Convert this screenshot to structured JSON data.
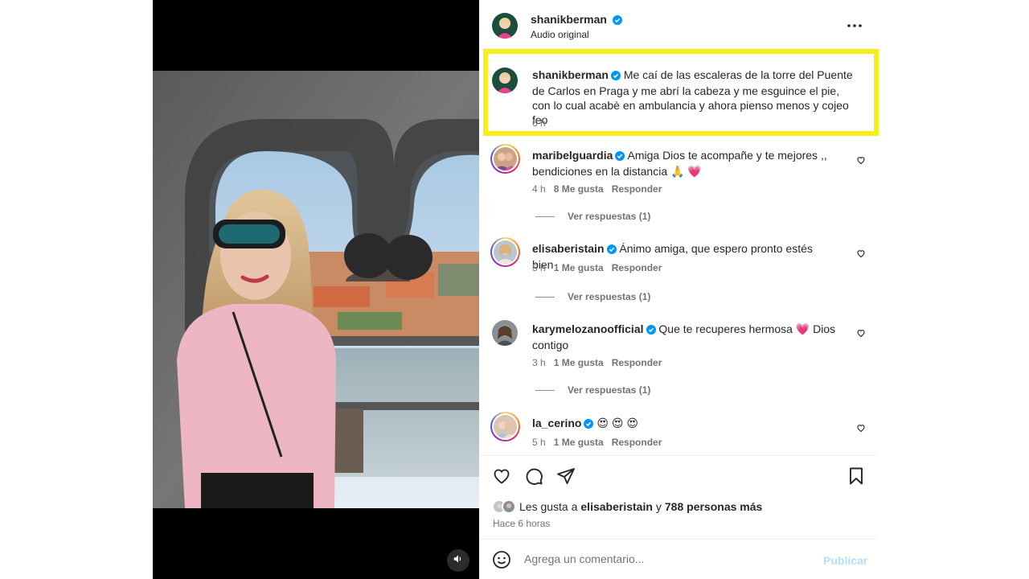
{
  "header": {
    "username": "shanikberman",
    "audio": "Audio original",
    "more_icon": "more-horizontal-icon"
  },
  "caption": {
    "username": "shanikberman",
    "text": "Me caí de las escaleras de la torre del Puente de Carlos en Praga y me abrí la cabeza y me esguince el pie, con lo cual acabè en ambulancia y ahora pienso menos y cojeo feo",
    "time": "6 h"
  },
  "comments": [
    {
      "username": "maribelguardia",
      "text": "Amiga Dios te acompañe y te mejores ,, bendiciones en la distancia 🙏 💗",
      "time": "4 h",
      "likes": "8 Me gusta",
      "reply": "Responder",
      "view_replies": "Ver respuestas (1)"
    },
    {
      "username": "elisaberistain",
      "text": "Ánimo amiga, que espero pronto estés bien",
      "time": "5 h",
      "likes": "1 Me gusta",
      "reply": "Responder",
      "view_replies": "Ver respuestas (1)"
    },
    {
      "username": "karymelozanoofficial",
      "text": "Que te recuperes hermosa 💗  Dios contigo",
      "time": "3 h",
      "likes": "1 Me gusta",
      "reply": "Responder",
      "view_replies": "Ver respuestas (1)"
    },
    {
      "username": "la_cerino",
      "text": "😍 😍 😍",
      "time": "5 h",
      "likes": "1 Me gusta",
      "reply": "Responder"
    }
  ],
  "actions": {
    "like_icon": "heart-icon",
    "comment_icon": "comment-icon",
    "share_icon": "send-icon",
    "save_icon": "bookmark-icon"
  },
  "likes": {
    "prefix": "Les gusta a",
    "user": "elisaberistain",
    "connector": "y",
    "others": "788 personas más"
  },
  "posted": "Hace 6 horas",
  "composer": {
    "placeholder": "Agrega un comentario...",
    "publish": "Publicar",
    "emoji_icon": "emoji-icon"
  },
  "media": {
    "volume_icon": "volume-icon"
  },
  "colors": {
    "highlight": "#f5ef1b",
    "verified": "#0095f6",
    "publish": "#b2dffc"
  }
}
